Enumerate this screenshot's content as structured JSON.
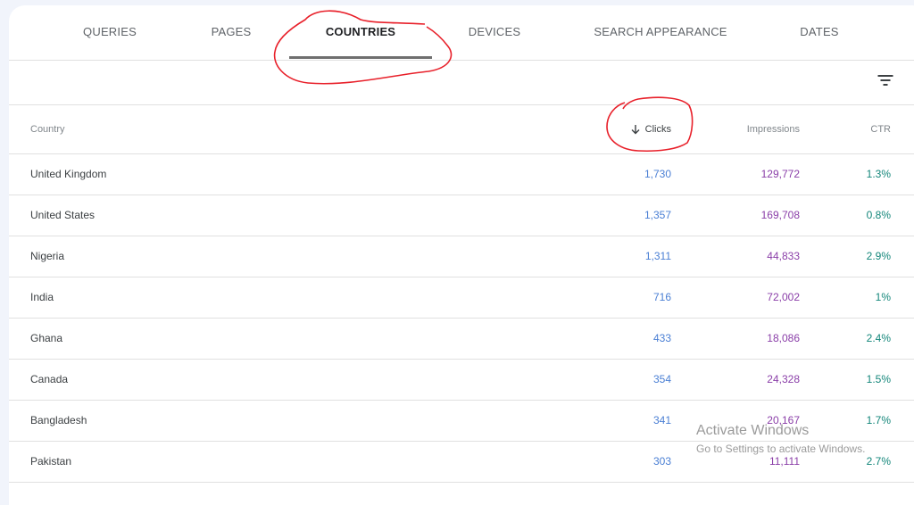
{
  "tabs": [
    {
      "label": "QUERIES",
      "active": false
    },
    {
      "label": "PAGES",
      "active": false
    },
    {
      "label": "COUNTRIES",
      "active": true
    },
    {
      "label": "DEVICES",
      "active": false
    },
    {
      "label": "SEARCH APPEARANCE",
      "active": false
    },
    {
      "label": "DATES",
      "active": false
    }
  ],
  "toolbar": {
    "filter_icon": "filter-list-icon"
  },
  "table": {
    "columns": {
      "country": "Country",
      "clicks": "Clicks",
      "impressions": "Impressions",
      "ctr": "CTR"
    },
    "sort": {
      "column": "Clicks",
      "direction": "descending",
      "icon": "arrow-down-icon"
    },
    "rows": [
      {
        "country": "United Kingdom",
        "clicks": "1,730",
        "impressions": "129,772",
        "ctr": "1.3%"
      },
      {
        "country": "United States",
        "clicks": "1,357",
        "impressions": "169,708",
        "ctr": "0.8%"
      },
      {
        "country": "Nigeria",
        "clicks": "1,311",
        "impressions": "44,833",
        "ctr": "2.9%"
      },
      {
        "country": "India",
        "clicks": "716",
        "impressions": "72,002",
        "ctr": "1%"
      },
      {
        "country": "Ghana",
        "clicks": "433",
        "impressions": "18,086",
        "ctr": "2.4%"
      },
      {
        "country": "Canada",
        "clicks": "354",
        "impressions": "24,328",
        "ctr": "1.5%"
      },
      {
        "country": "Bangladesh",
        "clicks": "341",
        "impressions": "20,167",
        "ctr": "1.7%"
      },
      {
        "country": "Pakistan",
        "clicks": "303",
        "impressions": "11,111",
        "ctr": "2.7%"
      }
    ]
  },
  "colors": {
    "clicks": "#4a7fd4",
    "impressions": "#8a3ea8",
    "ctr": "#13867a",
    "annotation": "#e8202a"
  },
  "watermark": {
    "line1": "Activate Windows",
    "line2": "Go to Settings to activate Windows."
  }
}
